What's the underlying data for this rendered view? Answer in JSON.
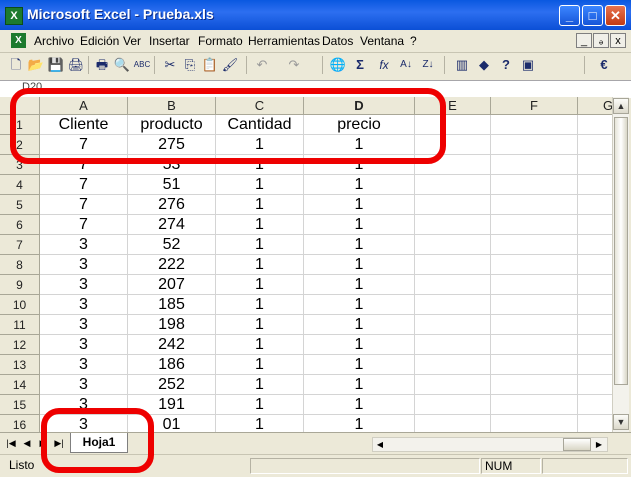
{
  "window": {
    "title": "Microsoft Excel - Prueba.xls"
  },
  "title_buttons": [
    "_",
    "□",
    "✕"
  ],
  "menu": [
    "Archivo",
    "Edición",
    "Ver",
    "Insertar",
    "Formato",
    "Herramientas",
    "Datos",
    "Ventana",
    "?"
  ],
  "doc_buttons": [
    "_",
    "ₔ",
    "x"
  ],
  "toolbar": {
    "icons": [
      "new-icon",
      "open-icon",
      "save-icon",
      "permission-icon",
      "print-icon",
      "print-preview-icon",
      "spelling-icon",
      "cut-icon",
      "copy-icon",
      "paste-icon",
      "format-painter-icon",
      "undo-icon",
      "redo-icon",
      "hyperlink-icon",
      "autosum-icon",
      "function-icon",
      "sort-ascending-icon",
      "sort-descending-icon",
      "chart-wizard-icon",
      "drawing-icon",
      "help-icon",
      "toolbar-options-icon",
      "currency-icon"
    ],
    "glyphs": [
      "🗋",
      "📂",
      "💾",
      "🖨",
      "🖶",
      "🔍",
      "ABC",
      "✂",
      "⎘",
      "📋",
      "🖌",
      "↶",
      "↷",
      "🌐",
      "Σ",
      "fx",
      "A↓",
      "Z↓",
      "▥",
      "◆",
      "?",
      "▣",
      "€"
    ]
  },
  "formula_bar": {
    "name_box": "D20"
  },
  "sheet": {
    "columns": [
      "A",
      "B",
      "C",
      "D",
      "E",
      "F",
      "G"
    ],
    "rows": [
      {
        "num": "1",
        "cells": [
          "Cliente",
          "producto",
          "Cantidad",
          "precio",
          "",
          "",
          ""
        ]
      },
      {
        "num": "2",
        "cells": [
          "7",
          "275",
          "1",
          "1",
          "",
          "",
          ""
        ]
      },
      {
        "num": "3",
        "cells": [
          "7",
          "53",
          "1",
          "1",
          "",
          "",
          ""
        ]
      },
      {
        "num": "4",
        "cells": [
          "7",
          "51",
          "1",
          "1",
          "",
          "",
          ""
        ]
      },
      {
        "num": "5",
        "cells": [
          "7",
          "276",
          "1",
          "1",
          "",
          "",
          ""
        ]
      },
      {
        "num": "6",
        "cells": [
          "7",
          "274",
          "1",
          "1",
          "",
          "",
          ""
        ]
      },
      {
        "num": "7",
        "cells": [
          "3",
          "52",
          "1",
          "1",
          "",
          "",
          ""
        ]
      },
      {
        "num": "8",
        "cells": [
          "3",
          "222",
          "1",
          "1",
          "",
          "",
          ""
        ]
      },
      {
        "num": "9",
        "cells": [
          "3",
          "207",
          "1",
          "1",
          "",
          "",
          ""
        ]
      },
      {
        "num": "10",
        "cells": [
          "3",
          "185",
          "1",
          "1",
          "",
          "",
          ""
        ]
      },
      {
        "num": "11",
        "cells": [
          "3",
          "198",
          "1",
          "1",
          "",
          "",
          ""
        ]
      },
      {
        "num": "12",
        "cells": [
          "3",
          "242",
          "1",
          "1",
          "",
          "",
          ""
        ]
      },
      {
        "num": "13",
        "cells": [
          "3",
          "186",
          "1",
          "1",
          "",
          "",
          ""
        ]
      },
      {
        "num": "14",
        "cells": [
          "3",
          "252",
          "1",
          "1",
          "",
          "",
          ""
        ]
      },
      {
        "num": "15",
        "cells": [
          "3",
          "191",
          "1",
          "1",
          "",
          "",
          ""
        ]
      },
      {
        "num": "16",
        "cells": [
          "3",
          "01",
          "1",
          "1",
          "",
          "",
          ""
        ]
      }
    ]
  },
  "tabs": {
    "active_sheet": "Hoja1",
    "nav_buttons": [
      "|◀",
      "◀",
      "▶",
      "▶|"
    ]
  },
  "status": {
    "text": "Listo",
    "num_indicator": "NUM"
  },
  "annotation_color": "#ee0000"
}
